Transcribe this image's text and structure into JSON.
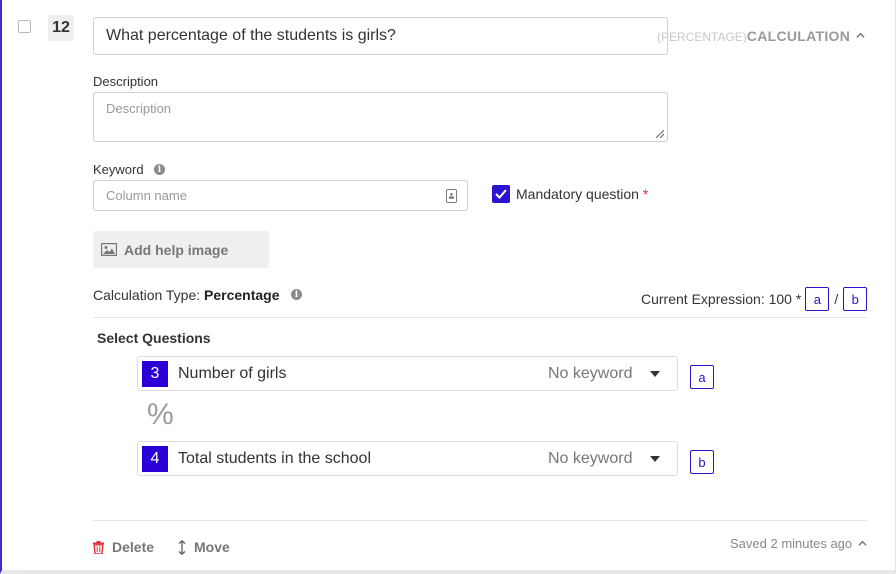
{
  "question": {
    "number": "12",
    "title": "What percentage of the students is girls?",
    "type_prefix": "(PERCENTAGE)",
    "type_label": "CALCULATION"
  },
  "description": {
    "label": "Description",
    "placeholder": "Description"
  },
  "keyword": {
    "label": "Keyword",
    "placeholder": "Column name"
  },
  "mandatory": {
    "label": "Mandatory question",
    "required_mark": "*",
    "checked": true
  },
  "help_image": {
    "label": "Add help image"
  },
  "calculation": {
    "type_label": "Calculation Type:",
    "type_value": "Percentage",
    "expression_label": "Current Expression: 100 *",
    "var_a": "a",
    "operator": "/",
    "var_b": "b"
  },
  "select_questions": {
    "heading": "Select Questions",
    "separator": "%",
    "items": [
      {
        "number": "3",
        "text": "Number of girls",
        "keyword": "No keyword",
        "variable": "a"
      },
      {
        "number": "4",
        "text": "Total students in the school",
        "keyword": "No keyword",
        "variable": "b"
      }
    ]
  },
  "footer": {
    "delete_label": "Delete",
    "move_label": "Move",
    "saved_text": "Saved 2 minutes ago"
  },
  "colors": {
    "accent": "#2a14cf",
    "danger": "#e0303a"
  }
}
